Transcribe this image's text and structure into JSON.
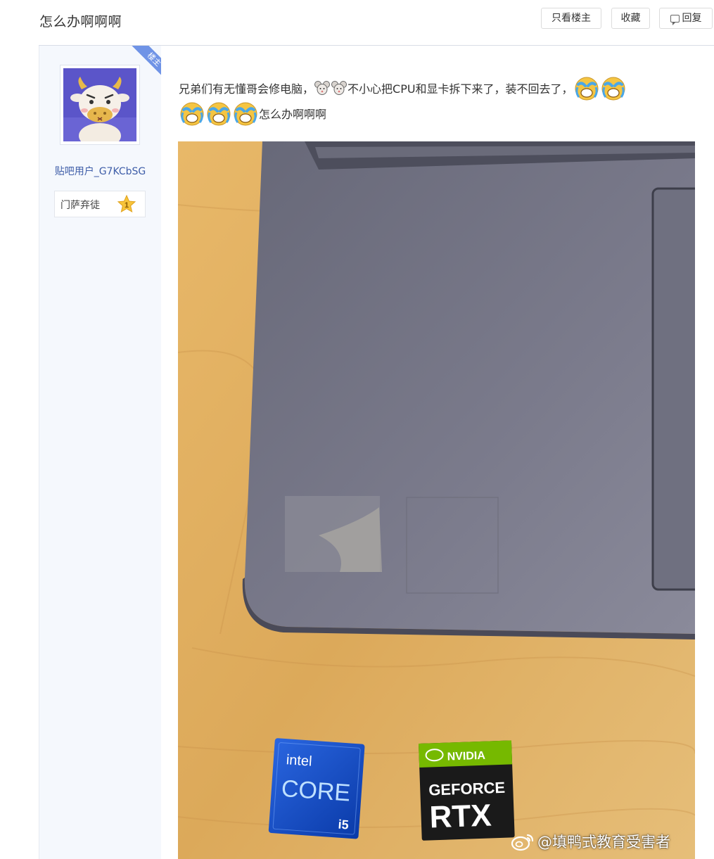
{
  "thread": {
    "title": "怎么办啊啊啊"
  },
  "toolbar": {
    "only_op_label": "只看楼主",
    "favorite_label": "收藏",
    "reply_label": "回复"
  },
  "author": {
    "op_badge": "楼主",
    "username": "贴吧用户_G7KCbSG",
    "level_name": "门萨弃徒",
    "level_number": "1"
  },
  "post": {
    "line1_part1": "兄弟们有无懂哥会修电脑，",
    "line1_part2": "不小心把CPU和显卡拆下来了，装不回去了，",
    "line2_text": "怎么办啊啊啊",
    "photo": {
      "stickers": {
        "intel_brand": "intel",
        "intel_product": "CORE",
        "intel_tier": "i5",
        "nvidia_brand": "NVIDIA",
        "nvidia_product": "GEFORCE",
        "nvidia_line": "RTX"
      }
    }
  },
  "watermark": {
    "text": "@填鸭式教育受害者"
  },
  "colors": {
    "link_blue": "#3e5da8",
    "badge_blue": "#6f93e6",
    "sidebar_bg": "#f5f8fd"
  }
}
